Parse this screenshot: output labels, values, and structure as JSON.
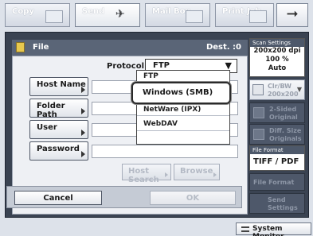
{
  "mode_tabs": [
    {
      "label": "Copy",
      "icon": "copy-icon"
    },
    {
      "label": "Send",
      "icon": "send-icon"
    },
    {
      "label": "Mail Box",
      "icon": "mailbox-icon"
    },
    {
      "label": "Print Job",
      "icon": "printjob-icon"
    }
  ],
  "next_arrow": "➞",
  "file_panel": {
    "title": "File",
    "dest_count": "Dest. :0",
    "protocol_label": "Protocol:",
    "protocol_value": "FTP",
    "fields": [
      "Host Name",
      "Folder Path",
      "User",
      "Password"
    ],
    "host_search": "Host Search",
    "browse": "Browse"
  },
  "protocol_dropdown": {
    "items": [
      "FTP",
      "Windows (SMB)",
      "NetWare (IPX)",
      "WebDAV"
    ],
    "selected": "Windows (SMB)"
  },
  "buttons": {
    "cancel": "Cancel",
    "ok": "OK"
  },
  "scan_settings": {
    "header": "Scan Settings",
    "resolution": "200x200 dpi",
    "zoom": "100 %",
    "density": "Auto",
    "color_mode_line1": "Clr/BW",
    "color_mode_line2": "200x200",
    "two_sided_line1": "2-Sided",
    "two_sided_line2": "Original",
    "diff_size_line1": "Diff. Size",
    "diff_size_line2": "Originals"
  },
  "file_format": {
    "header": "File Format",
    "value": "TIFF / PDF",
    "button": "File Format"
  },
  "send_settings": {
    "line1": "Send",
    "line2": "Settings"
  },
  "system_monitor": "System Monitor"
}
